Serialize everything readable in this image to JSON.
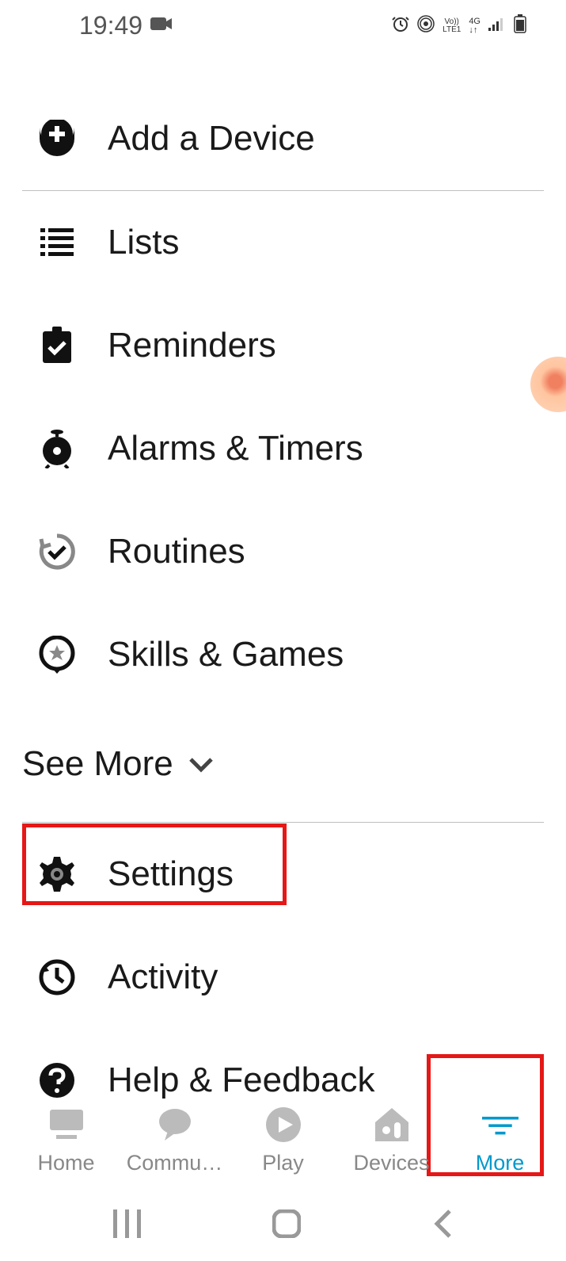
{
  "statusBar": {
    "time": "19:49",
    "icons": {
      "camera": "camera",
      "alarm": "alarm",
      "hotspot": "hotspot",
      "volte": "Vo)) LTE1",
      "network": "4G",
      "signal": "signal",
      "battery": "battery"
    }
  },
  "menu": {
    "items": [
      {
        "icon": "add-device",
        "label": "Add a Device"
      },
      {
        "icon": "list",
        "label": "Lists"
      },
      {
        "icon": "reminders",
        "label": "Reminders"
      },
      {
        "icon": "alarms",
        "label": "Alarms & Timers"
      },
      {
        "icon": "routines",
        "label": "Routines"
      },
      {
        "icon": "skills",
        "label": "Skills & Games"
      }
    ],
    "seeMore": "See More",
    "bottomItems": [
      {
        "icon": "settings",
        "label": "Settings"
      },
      {
        "icon": "activity",
        "label": "Activity"
      },
      {
        "icon": "help",
        "label": "Help & Feedback"
      }
    ]
  },
  "bottomNav": {
    "items": [
      {
        "icon": "home",
        "label": "Home",
        "active": false
      },
      {
        "icon": "communicate",
        "label": "Commu…",
        "active": false
      },
      {
        "icon": "play",
        "label": "Play",
        "active": false
      },
      {
        "icon": "devices",
        "label": "Devices",
        "active": false
      },
      {
        "icon": "more",
        "label": "More",
        "active": true
      }
    ]
  }
}
